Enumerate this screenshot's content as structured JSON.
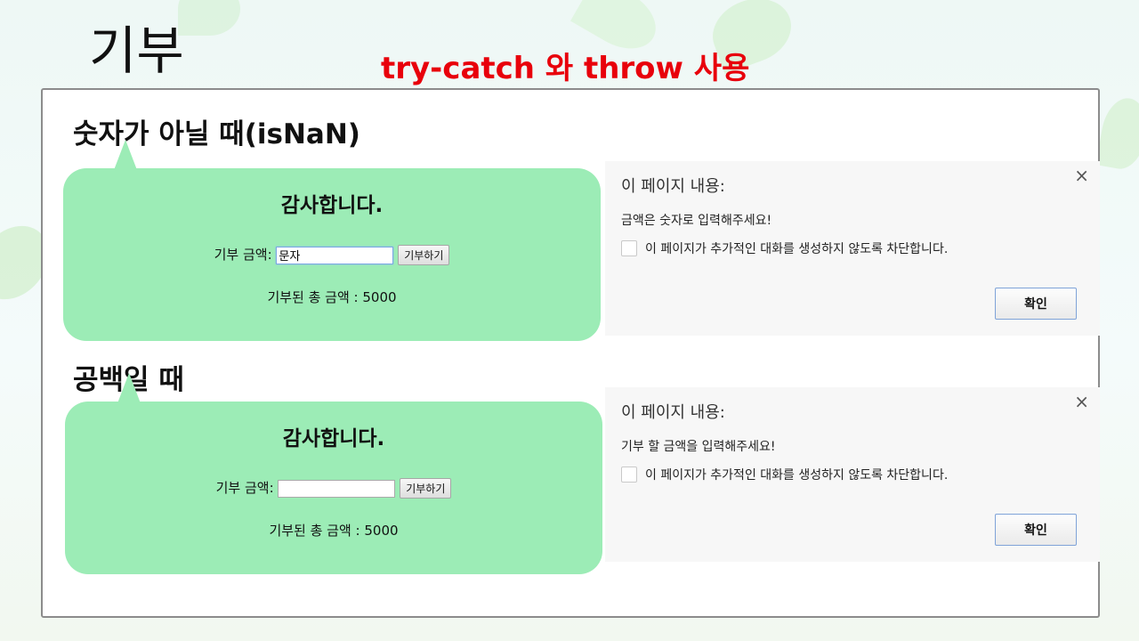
{
  "slide": {
    "title": "기부",
    "subtitle": "try-catch 와 throw 사용"
  },
  "cases": [
    {
      "heading": "숫자가 아닐 때(isNaN)",
      "bubble_title": "감사합니다.",
      "field_label": "기부 금액:",
      "input_value": "문자",
      "button_label": "기부하기",
      "total_text": "기부된 총 금액 : 5000",
      "dialog": {
        "title": "이 페이지 내용:",
        "message": "금액은 숫자로 입력해주세요!",
        "checkbox_label": "이 페이지가 추가적인 대화를 생성하지 않도록 차단합니다.",
        "ok_label": "확인",
        "close_icon": "×"
      }
    },
    {
      "heading": "공백일 때",
      "bubble_title": "감사합니다.",
      "field_label": "기부 금액:",
      "input_value": "",
      "button_label": "기부하기",
      "total_text": "기부된 총 금액 : 5000",
      "dialog": {
        "title": "이 페이지 내용:",
        "message": "기부 할 금액을 입력해주세요!",
        "checkbox_label": "이 페이지가 추가적인 대화를 생성하지 않도록 차단합니다.",
        "ok_label": "확인",
        "close_icon": "×"
      }
    }
  ],
  "colors": {
    "subtitle": "#e8000b",
    "bubble": "#9cecb6",
    "dialog_bg": "#f7f7f7"
  }
}
